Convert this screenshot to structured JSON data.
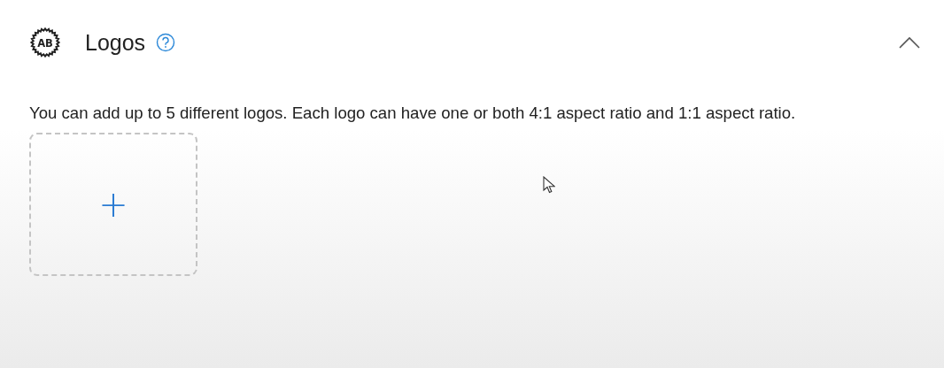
{
  "section": {
    "icon_label": "AB",
    "title": "Logos",
    "expanded": true,
    "description": "You can add up to 5 different logos. Each logo can have one or both 4:1 aspect ratio and 1:1 aspect ratio.",
    "add_tile": {
      "symbol": "+"
    }
  }
}
